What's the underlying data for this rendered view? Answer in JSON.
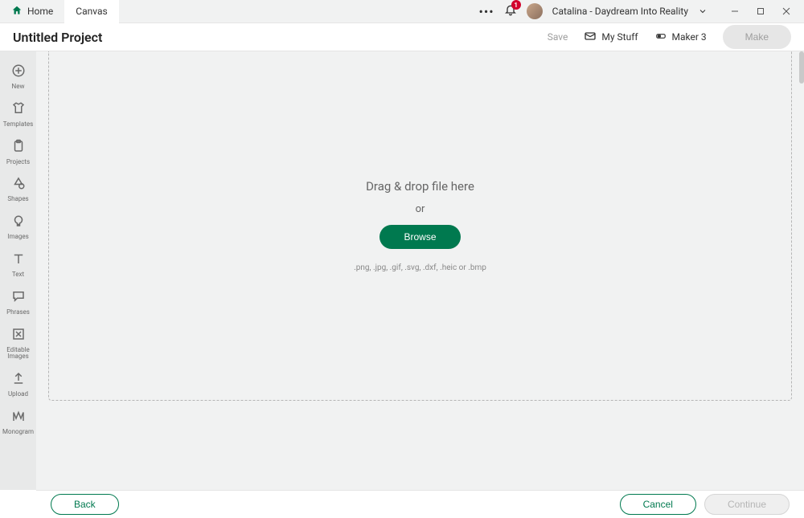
{
  "tabs": {
    "home": "Home",
    "canvas": "Canvas"
  },
  "notifications": {
    "count": "1"
  },
  "user": {
    "name": "Catalina - Daydream Into Reality"
  },
  "project": {
    "title": "Untitled Project"
  },
  "header": {
    "save": "Save",
    "my_stuff": "My Stuff",
    "maker": "Maker 3",
    "make": "Make"
  },
  "sidebar": {
    "items": [
      {
        "label": "New"
      },
      {
        "label": "Templates"
      },
      {
        "label": "Projects"
      },
      {
        "label": "Shapes"
      },
      {
        "label": "Images"
      },
      {
        "label": "Text"
      },
      {
        "label": "Phrases"
      },
      {
        "label": "Editable Images"
      },
      {
        "label": "Upload"
      },
      {
        "label": "Monogram"
      }
    ]
  },
  "dropzone": {
    "title": "Drag & drop file here",
    "or": "or",
    "browse": "Browse",
    "formats": ".png, .jpg, .gif, .svg, .dxf, .heic or .bmp"
  },
  "footer": {
    "back": "Back",
    "cancel": "Cancel",
    "continue": "Continue"
  }
}
